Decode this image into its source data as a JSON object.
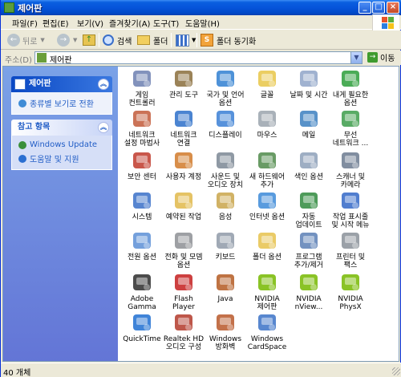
{
  "window": {
    "title": "제어판"
  },
  "menu": [
    "파일(F)",
    "편집(E)",
    "보기(V)",
    "즐겨찾기(A)",
    "도구(T)",
    "도움말(H)"
  ],
  "toolbar": {
    "back": "뒤로",
    "search": "검색",
    "folders": "폴더",
    "folder_sync": "폴더 동기화"
  },
  "address": {
    "label": "주소(D)",
    "value": "제어판",
    "go": "이동"
  },
  "sidebar": {
    "panel1": {
      "title": "제어판",
      "link": "종류별 보기로 전환"
    },
    "panel2": {
      "title": "참고 항목",
      "links": [
        "Windows Update",
        "도움말 및 지원"
      ]
    }
  },
  "icons": [
    {
      "label": "게임\n컨트롤러",
      "icon": "game-controller-icon",
      "color": "#6c7fb0"
    },
    {
      "label": "관리 도구",
      "icon": "admin-tools-icon",
      "color": "#8a6d3b"
    },
    {
      "label": "국가 및 언어\n옵션",
      "icon": "globe-icon",
      "color": "#2f7fd1"
    },
    {
      "label": "글꼴",
      "icon": "fonts-folder-icon",
      "color": "#e8c547"
    },
    {
      "label": "날짜 및 시간",
      "icon": "clock-icon",
      "color": "#8fa4c8"
    },
    {
      "label": "내게 필요한\n옵션",
      "icon": "accessibility-icon",
      "color": "#2c9d3a"
    },
    {
      "label": "네트워크\n설정 마법사",
      "icon": "network-house-icon",
      "color": "#c25a3a"
    },
    {
      "label": "네트워크\n연결",
      "icon": "network-connections-icon",
      "color": "#2b6fc9"
    },
    {
      "label": "디스플레이",
      "icon": "display-icon",
      "color": "#3a7fd5"
    },
    {
      "label": "마우스",
      "icon": "mouse-icon",
      "color": "#9aa3ad"
    },
    {
      "label": "메일",
      "icon": "mail-icon",
      "color": "#3b7fc0"
    },
    {
      "label": "무선\n네트워크 ...",
      "icon": "wireless-icon",
      "color": "#3c9c4a"
    },
    {
      "label": "보안 센터",
      "icon": "security-shield-icon",
      "color": "#c0392b"
    },
    {
      "label": "사용자 계정",
      "icon": "user-accounts-icon",
      "color": "#d17a2a"
    },
    {
      "label": "사운드 및\n오디오 장치",
      "icon": "speaker-icon",
      "color": "#7b8794"
    },
    {
      "label": "새 하드웨어\n추가",
      "icon": "hardware-icon",
      "color": "#4f8a4a"
    },
    {
      "label": "색인 옵션",
      "icon": "index-search-icon",
      "color": "#8da0b8"
    },
    {
      "label": "스캐너 및\n카메라",
      "icon": "scanner-camera-icon",
      "color": "#6b7a8f"
    },
    {
      "label": "시스템",
      "icon": "system-icon",
      "color": "#3a70c8"
    },
    {
      "label": "예약된 작업",
      "icon": "scheduled-tasks-icon",
      "color": "#e0b84a"
    },
    {
      "label": "음성",
      "icon": "speech-icon",
      "color": "#c9a44a"
    },
    {
      "label": "인터넷 옵션",
      "icon": "internet-options-icon",
      "color": "#3c8ad8"
    },
    {
      "label": "자동\n업데이트",
      "icon": "windows-update-icon",
      "color": "#2f8a3d"
    },
    {
      "label": "작업 표시줄\n및 시작 메뉴",
      "icon": "taskbar-icon",
      "color": "#3367c7"
    },
    {
      "label": "전원 옵션",
      "icon": "power-icon",
      "color": "#5c8fd6"
    },
    {
      "label": "전화 및 모뎀\n옵션",
      "icon": "phone-modem-icon",
      "color": "#8d8f94"
    },
    {
      "label": "키보드",
      "icon": "keyboard-icon",
      "color": "#8f9aa8"
    },
    {
      "label": "폴더 옵션",
      "icon": "folder-options-icon",
      "color": "#e6c24c"
    },
    {
      "label": "프로그램\n추가/제거",
      "icon": "add-remove-programs-icon",
      "color": "#5b7fb5"
    },
    {
      "label": "프린터 및\n팩스",
      "icon": "printer-icon",
      "color": "#8a9099"
    },
    {
      "label": "Adobe\nGamma",
      "icon": "adobe-gamma-icon",
      "color": "#2d2d2d"
    },
    {
      "label": "Flash Player",
      "icon": "flash-player-icon",
      "color": "#c41e1e"
    },
    {
      "label": "Java",
      "icon": "java-icon",
      "color": "#b45b22"
    },
    {
      "label": "NVIDIA\n제어판",
      "icon": "nvidia-control-panel-icon",
      "color": "#76b900"
    },
    {
      "label": "NVIDIA\nnView...",
      "icon": "nvidia-nview-icon",
      "color": "#76b900"
    },
    {
      "label": "NVIDIA\nPhysX",
      "icon": "nvidia-physx-icon",
      "color": "#76b900"
    },
    {
      "label": "QuickTime",
      "icon": "quicktime-icon",
      "color": "#1f6fd1"
    },
    {
      "label": "Realtek HD\n오디오 구성",
      "icon": "realtek-audio-icon",
      "color": "#b33a2a"
    },
    {
      "label": "Windows\n방화벽",
      "icon": "firewall-icon",
      "color": "#b8582a"
    },
    {
      "label": "Windows\nCardSpace",
      "icon": "cardspace-icon",
      "color": "#3b72c7"
    }
  ],
  "status": {
    "text": "40 개체"
  }
}
